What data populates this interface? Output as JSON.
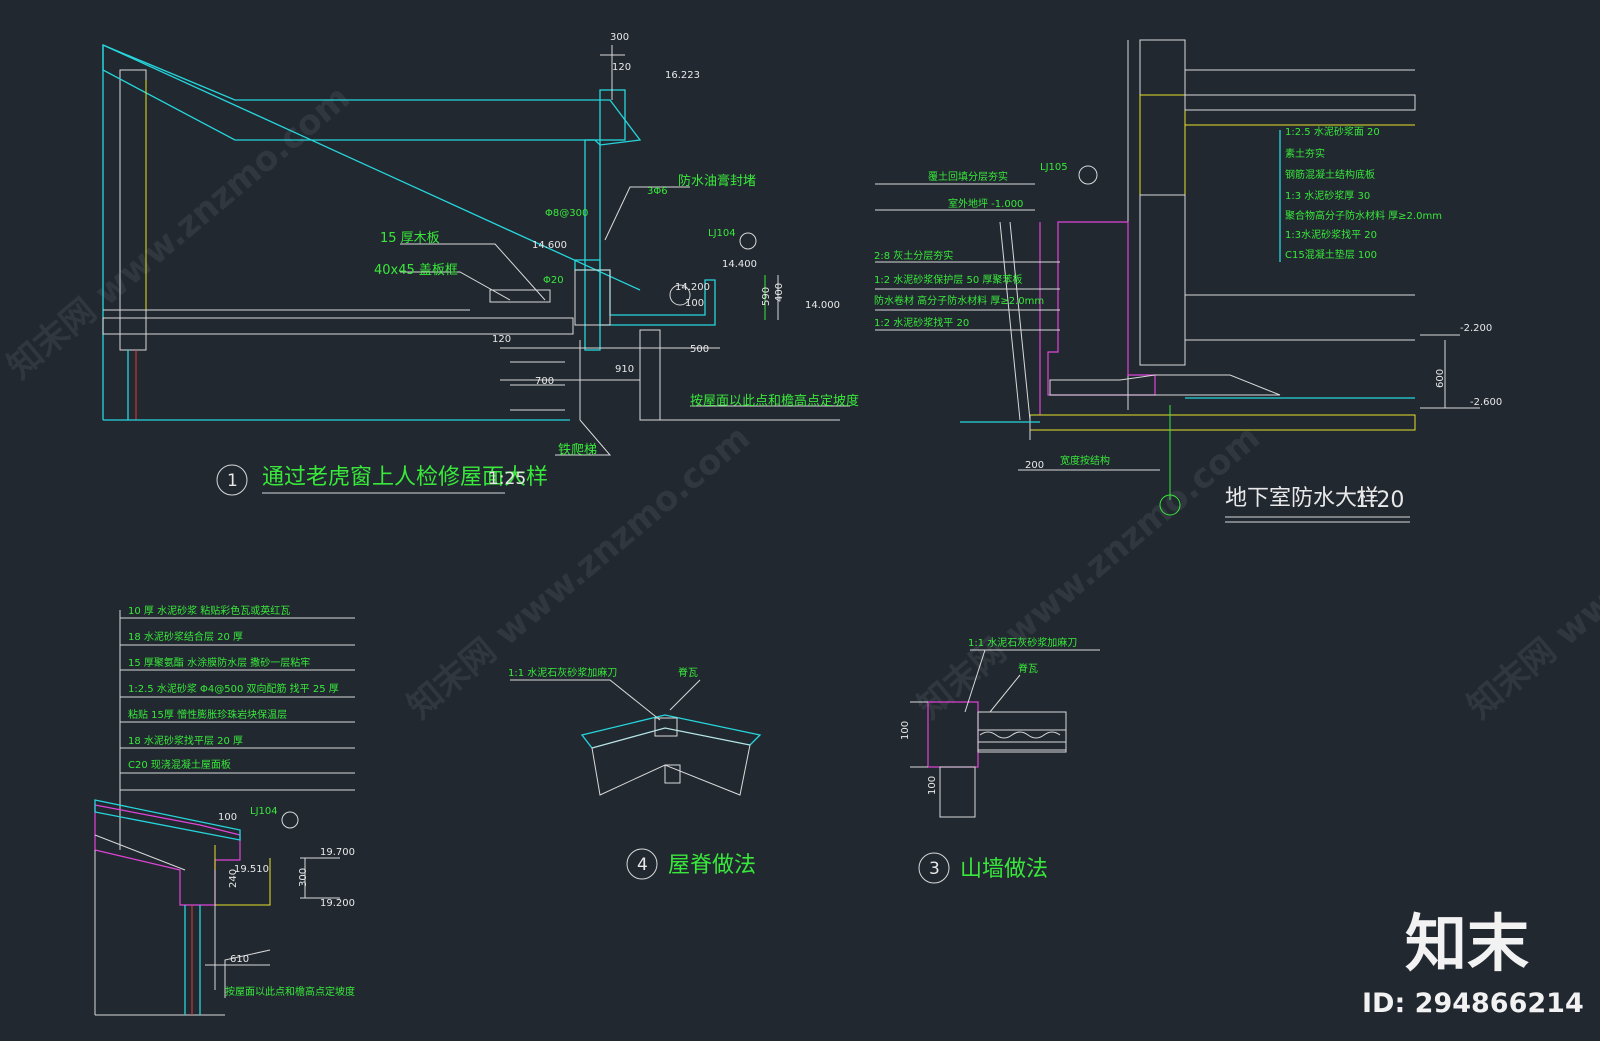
{
  "detail1": {
    "title": "通过老虎窗上人检修屋面大样",
    "scale": "1:25",
    "number": "1",
    "labels": {
      "board": "15 厚木板",
      "frame": "40x45 盖板框",
      "seal": "防水油膏封堵",
      "steel": "铁爬梯",
      "slope": "按屋面以此点和檐高点定坡度",
      "rebar": "Φ8@300",
      "bar": "3Φ6",
      "drain": "Φ20"
    },
    "dims": [
      "300",
      "120",
      "16.223",
      "14.600",
      "14.200",
      "14.400",
      "14.000",
      "590",
      "400",
      "120",
      "700",
      "910",
      "500",
      "100",
      "LJ104"
    ]
  },
  "detail2": {
    "title": "地下室防水大样",
    "scale": "1:20",
    "layers_left": [
      "覆土回填分层夯实",
      "室外地坪 -1.000",
      "2:8 灰土分层夯实",
      "1:2 水泥砂浆保护层 50 厚聚苯板",
      "防水卷材 高分子防水材料 厚≥2.0mm",
      "1:2 水泥砂浆找平 20"
    ],
    "layers_right": [
      "1:2.5 水泥砂浆面 20",
      "素土夯实",
      "钢筋混凝土结构底板",
      "1:3 水泥砂浆厚 30",
      "聚合物高分子防水材料 厚≥2.0mm",
      "1:3水泥砂浆找平 20",
      "C15混凝土垫层 100"
    ],
    "dims": [
      "LJ105",
      "-2.200",
      "-2.600",
      "600",
      "200",
      "宽度按结构"
    ]
  },
  "detail3": {
    "title": "山墙做法",
    "number": "3",
    "labels": {
      "mortar": "1:1 水泥石灰砂浆加麻刀",
      "ridge_tile": "脊瓦"
    },
    "dims": [
      "100",
      "100"
    ]
  },
  "detail4": {
    "title": "屋脊做法",
    "number": "4",
    "labels": {
      "mortar": "1:1 水泥石灰砂浆加麻刀",
      "ridge_tile": "脊瓦"
    }
  },
  "detail5": {
    "layers": [
      "10 厚 水泥砂浆 粘贴彩色瓦或英红瓦",
      "18 水泥砂浆结合层 20 厚",
      "15 厚聚氨酯 水涂膜防水层 撒砂一层粘牢",
      "1:2.5 水泥砂浆 Φ4@500 双向配筋 找平 25 厚",
      "粘贴 15厚 憎性膨胀珍珠岩块保温层",
      "18 水泥砂浆找平层 20 厚",
      "C20 现浇混凝土屋面板"
    ],
    "slope": "按屋面以此点和檐高点定坡度",
    "dims": [
      "LJ104",
      "100",
      "19.700",
      "19.510",
      "19.200",
      "300",
      "240",
      "610"
    ]
  },
  "watermark": "知末网 www.znzmo.com",
  "brand": {
    "name": "知末",
    "id": "ID: 294866214"
  },
  "colors": {
    "background": "#212830",
    "cyan": "#26d6dc",
    "green": "#38e83a",
    "magenta": "#e044d8",
    "white": "#d9d9d9",
    "yellow": "#e8e02a",
    "red": "#e23a3a"
  }
}
